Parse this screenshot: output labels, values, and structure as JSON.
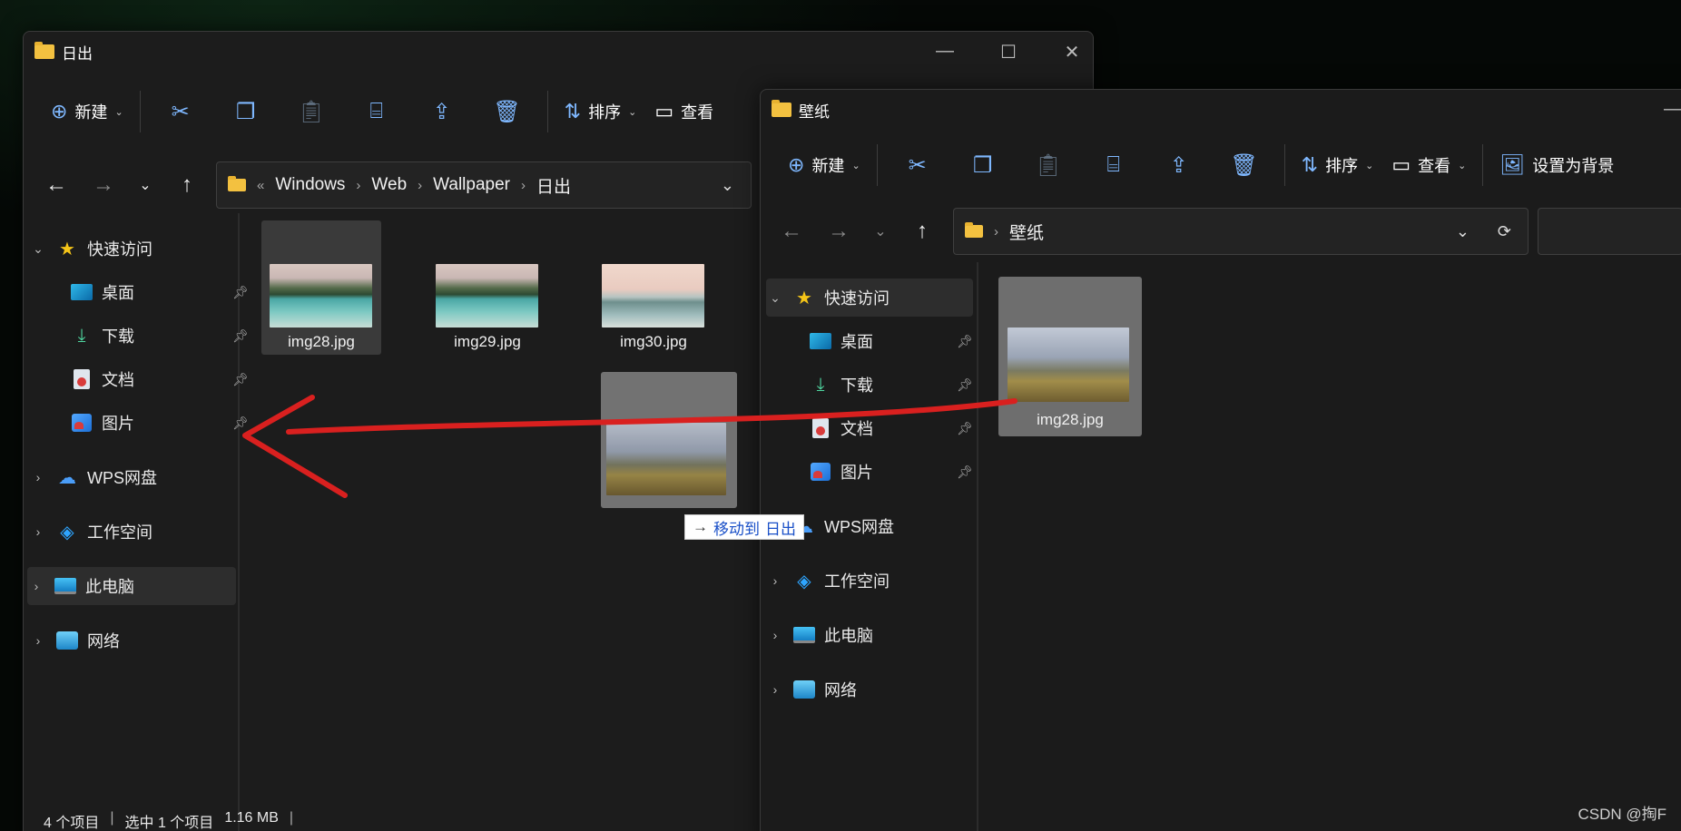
{
  "win_left": {
    "title": "日出",
    "toolbar": {
      "new_label": "新建",
      "sort_label": "排序",
      "view_label": "查看"
    },
    "breadcrumb": [
      "Windows",
      "Web",
      "Wallpaper",
      "日出"
    ],
    "breadcrumb_overflow": "«",
    "sidebar": {
      "quick_access": "快速访问",
      "items": [
        {
          "label": "桌面",
          "icon": "desktop-icon"
        },
        {
          "label": "下载",
          "icon": "download-icon"
        },
        {
          "label": "文档",
          "icon": "documents-icon"
        },
        {
          "label": "图片",
          "icon": "pictures-icon"
        }
      ],
      "wps": "WPS网盘",
      "workspace": "工作空间",
      "this_pc": "此电脑",
      "network": "网络"
    },
    "files": [
      {
        "name": "img28.jpg",
        "selected": true
      },
      {
        "name": "img29.jpg",
        "selected": false
      },
      {
        "name": "img30.jpg",
        "selected": false
      }
    ],
    "status": {
      "count": "4 个项目",
      "selected": "选中 1 个项目",
      "size": "1.16 MB"
    }
  },
  "win_right": {
    "title": "壁纸",
    "toolbar": {
      "new_label": "新建",
      "sort_label": "排序",
      "view_label": "查看",
      "set_bg_label": "设置为背景"
    },
    "breadcrumb": [
      "壁纸"
    ],
    "sidebar": {
      "quick_access": "快速访问",
      "items": [
        {
          "label": "桌面",
          "icon": "desktop-icon"
        },
        {
          "label": "下载",
          "icon": "download-icon"
        },
        {
          "label": "文档",
          "icon": "documents-icon"
        },
        {
          "label": "图片",
          "icon": "pictures-icon"
        }
      ],
      "wps": "WPS网盘",
      "workspace": "工作空间",
      "this_pc": "此电脑",
      "network": "网络"
    },
    "files": [
      {
        "name": "img28.jpg",
        "selected": true
      }
    ]
  },
  "drag_tooltip": {
    "action": "移动到",
    "target": "日出"
  },
  "annotation_color": "#d9201f",
  "watermark": "CSDN @掏F"
}
